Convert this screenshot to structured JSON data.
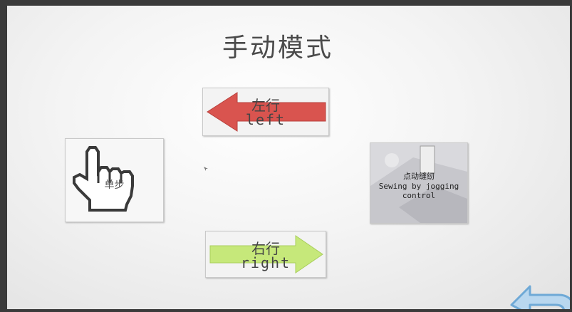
{
  "screen": {
    "title": "手动模式"
  },
  "buttons": {
    "left": {
      "zh": "左行",
      "en": "left",
      "arrow_color": "#d9544f"
    },
    "right": {
      "zh": "右行",
      "en": "right",
      "arrow_color": "#c6e87a"
    },
    "step": {
      "zh": "单步",
      "icon": "pointing-hand-icon"
    },
    "jog": {
      "zh": "点动缝纫",
      "en": "Sewing by jogging control",
      "icon": "sewing-machine-icon"
    },
    "back": {
      "icon": "return-arrow-icon",
      "color": "#6fa9d6"
    }
  }
}
